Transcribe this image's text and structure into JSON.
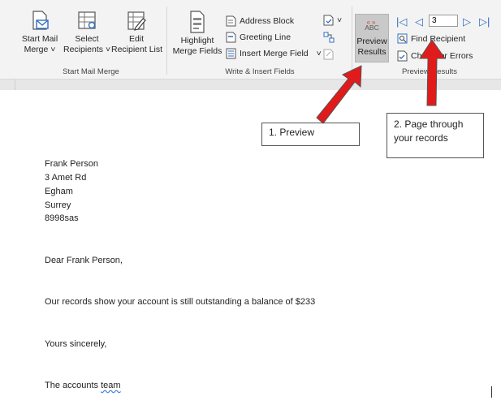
{
  "ribbon": {
    "start_mail_merge": {
      "start_label1": "Start Mail",
      "start_label2": "Merge ˅",
      "select_label1": "Select",
      "select_label2": "Recipients ˅",
      "edit_label1": "Edit",
      "edit_label2": "Recipient List",
      "group_label": "Start Mail Merge"
    },
    "write_insert": {
      "highlight_label1": "Highlight",
      "highlight_label2": "Merge Fields",
      "address_block": "Address Block",
      "greeting_line": "Greeting Line",
      "insert_merge_field": "Insert Merge Field",
      "dropdown_glyph": "˅",
      "group_label": "Write & Insert Fields"
    },
    "preview": {
      "abc": "ABC",
      "preview_label1": "Preview",
      "preview_label2": "Results",
      "record_value": "3",
      "find_recipient": "Find Recipient",
      "check_errors": "Check for Errors",
      "group_label": "Preview Results"
    }
  },
  "callouts": {
    "one": "1. Preview",
    "two_line1": "2.  Page through",
    "two_line2": "your records"
  },
  "letter": {
    "address": [
      "Frank Person",
      "3 Amet Rd",
      "Egham",
      "Surrey",
      "8998sas"
    ],
    "salutation": "Dear Frank Person,",
    "body": "Our records show your account is still outstanding a balance of $233",
    "closing": "Yours sincerely,",
    "signature_prefix": "The accounts ",
    "signature_word": "team"
  },
  "colors": {
    "ribbon_bg": "#f3f3f3",
    "accent_blue": "#2f6ec3",
    "arrow_red": "#e11b1b",
    "preview_active": "#c9c9c9"
  }
}
